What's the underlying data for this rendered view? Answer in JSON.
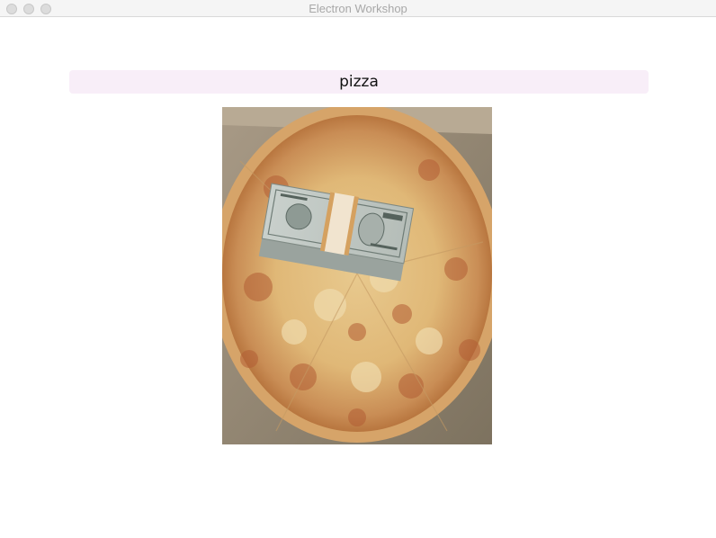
{
  "window": {
    "title": "Electron Workshop"
  },
  "search": {
    "value": "pizza"
  },
  "result_image": {
    "description_icon": "pizza-photo"
  },
  "colors": {
    "search_bg": "#f8eef8",
    "titlebar_bg": "#f5f5f5"
  }
}
